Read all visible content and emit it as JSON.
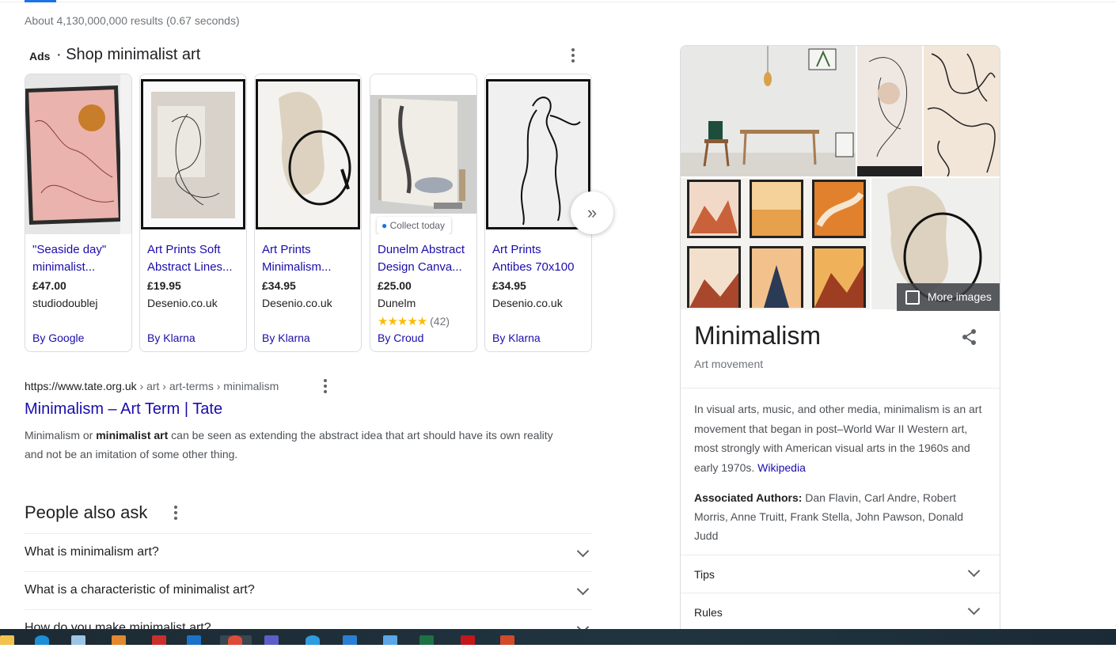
{
  "result_stats": "About 4,130,000,000 results (0.67 seconds)",
  "ads": {
    "label": "Ads",
    "title": "· Shop minimalist art",
    "more_icon": "more-vert-icon",
    "next_icon": "double-chevron-right-icon",
    "products": [
      {
        "title_line1": "\"Seaside day\"",
        "title_line2": "minimalist...",
        "price": "£47.00",
        "store": "studiodoublej",
        "by": "By Google"
      },
      {
        "title_line1": "Art Prints Soft",
        "title_line2": "Abstract Lines...",
        "price": "£19.95",
        "store": "Desenio.co.uk",
        "by": "By Klarna"
      },
      {
        "title_line1": "Art Prints",
        "title_line2": "Minimalism...",
        "price": "£34.95",
        "store": "Desenio.co.uk",
        "by": "By Klarna"
      },
      {
        "title_line1": "Dunelm Abstract",
        "title_line2": "Design Canva...",
        "price": "£25.00",
        "store": "Dunelm",
        "badge": "Collect today",
        "stars": "★★★★★",
        "rating": 5,
        "reviews": "(42)",
        "by": "By Croud"
      },
      {
        "title_line1": "Art Prints",
        "title_line2": "Antibes 70x100",
        "price": "£34.95",
        "store": "Desenio.co.uk",
        "by": "By Klarna"
      }
    ]
  },
  "result": {
    "url_domain": "https://www.tate.org.uk",
    "url_path": " › art › art-terms › minimalism",
    "title": "Minimalism – Art Term | Tate",
    "snippet_pre": "Minimalism or ",
    "snippet_bold": "minimalist art",
    "snippet_post": " can be seen as extending the abstract idea that art should have its own reality and not be an imitation of some other thing."
  },
  "paa": {
    "title": "People also ask",
    "questions": [
      "What is minimalism art?",
      "What is a characteristic of minimalist art?",
      "How do you make minimalist art?"
    ]
  },
  "knowledge_panel": {
    "more_images": "More images",
    "title": "Minimalism",
    "subtitle": "Art movement",
    "share_icon": "share-icon",
    "description": "In visual arts, music, and other media, minimalism is an art movement that began in post–World War II Western art, most strongly with American visual arts in the 1960s and early 1970s. ",
    "source_link": "Wikipedia",
    "authors_label": "Associated Authors: ",
    "authors": "Dan Flavin, Carl Andre, Robert Morris, Anne Truitt, Frank Stella, John Pawson, Donald Judd",
    "rows": [
      "Tips",
      "Rules"
    ]
  },
  "taskbar": {
    "apps": [
      "file-explorer-icon",
      "skype-icon",
      "notepad-icon",
      "sublime-icon",
      "filezilla-icon",
      "outlook-icon",
      "chrome-icon",
      "teams-icon",
      "edge-icon",
      "mail-icon",
      "photos-icon",
      "excel-icon",
      "acrobat-icon",
      "paint-icon"
    ]
  }
}
